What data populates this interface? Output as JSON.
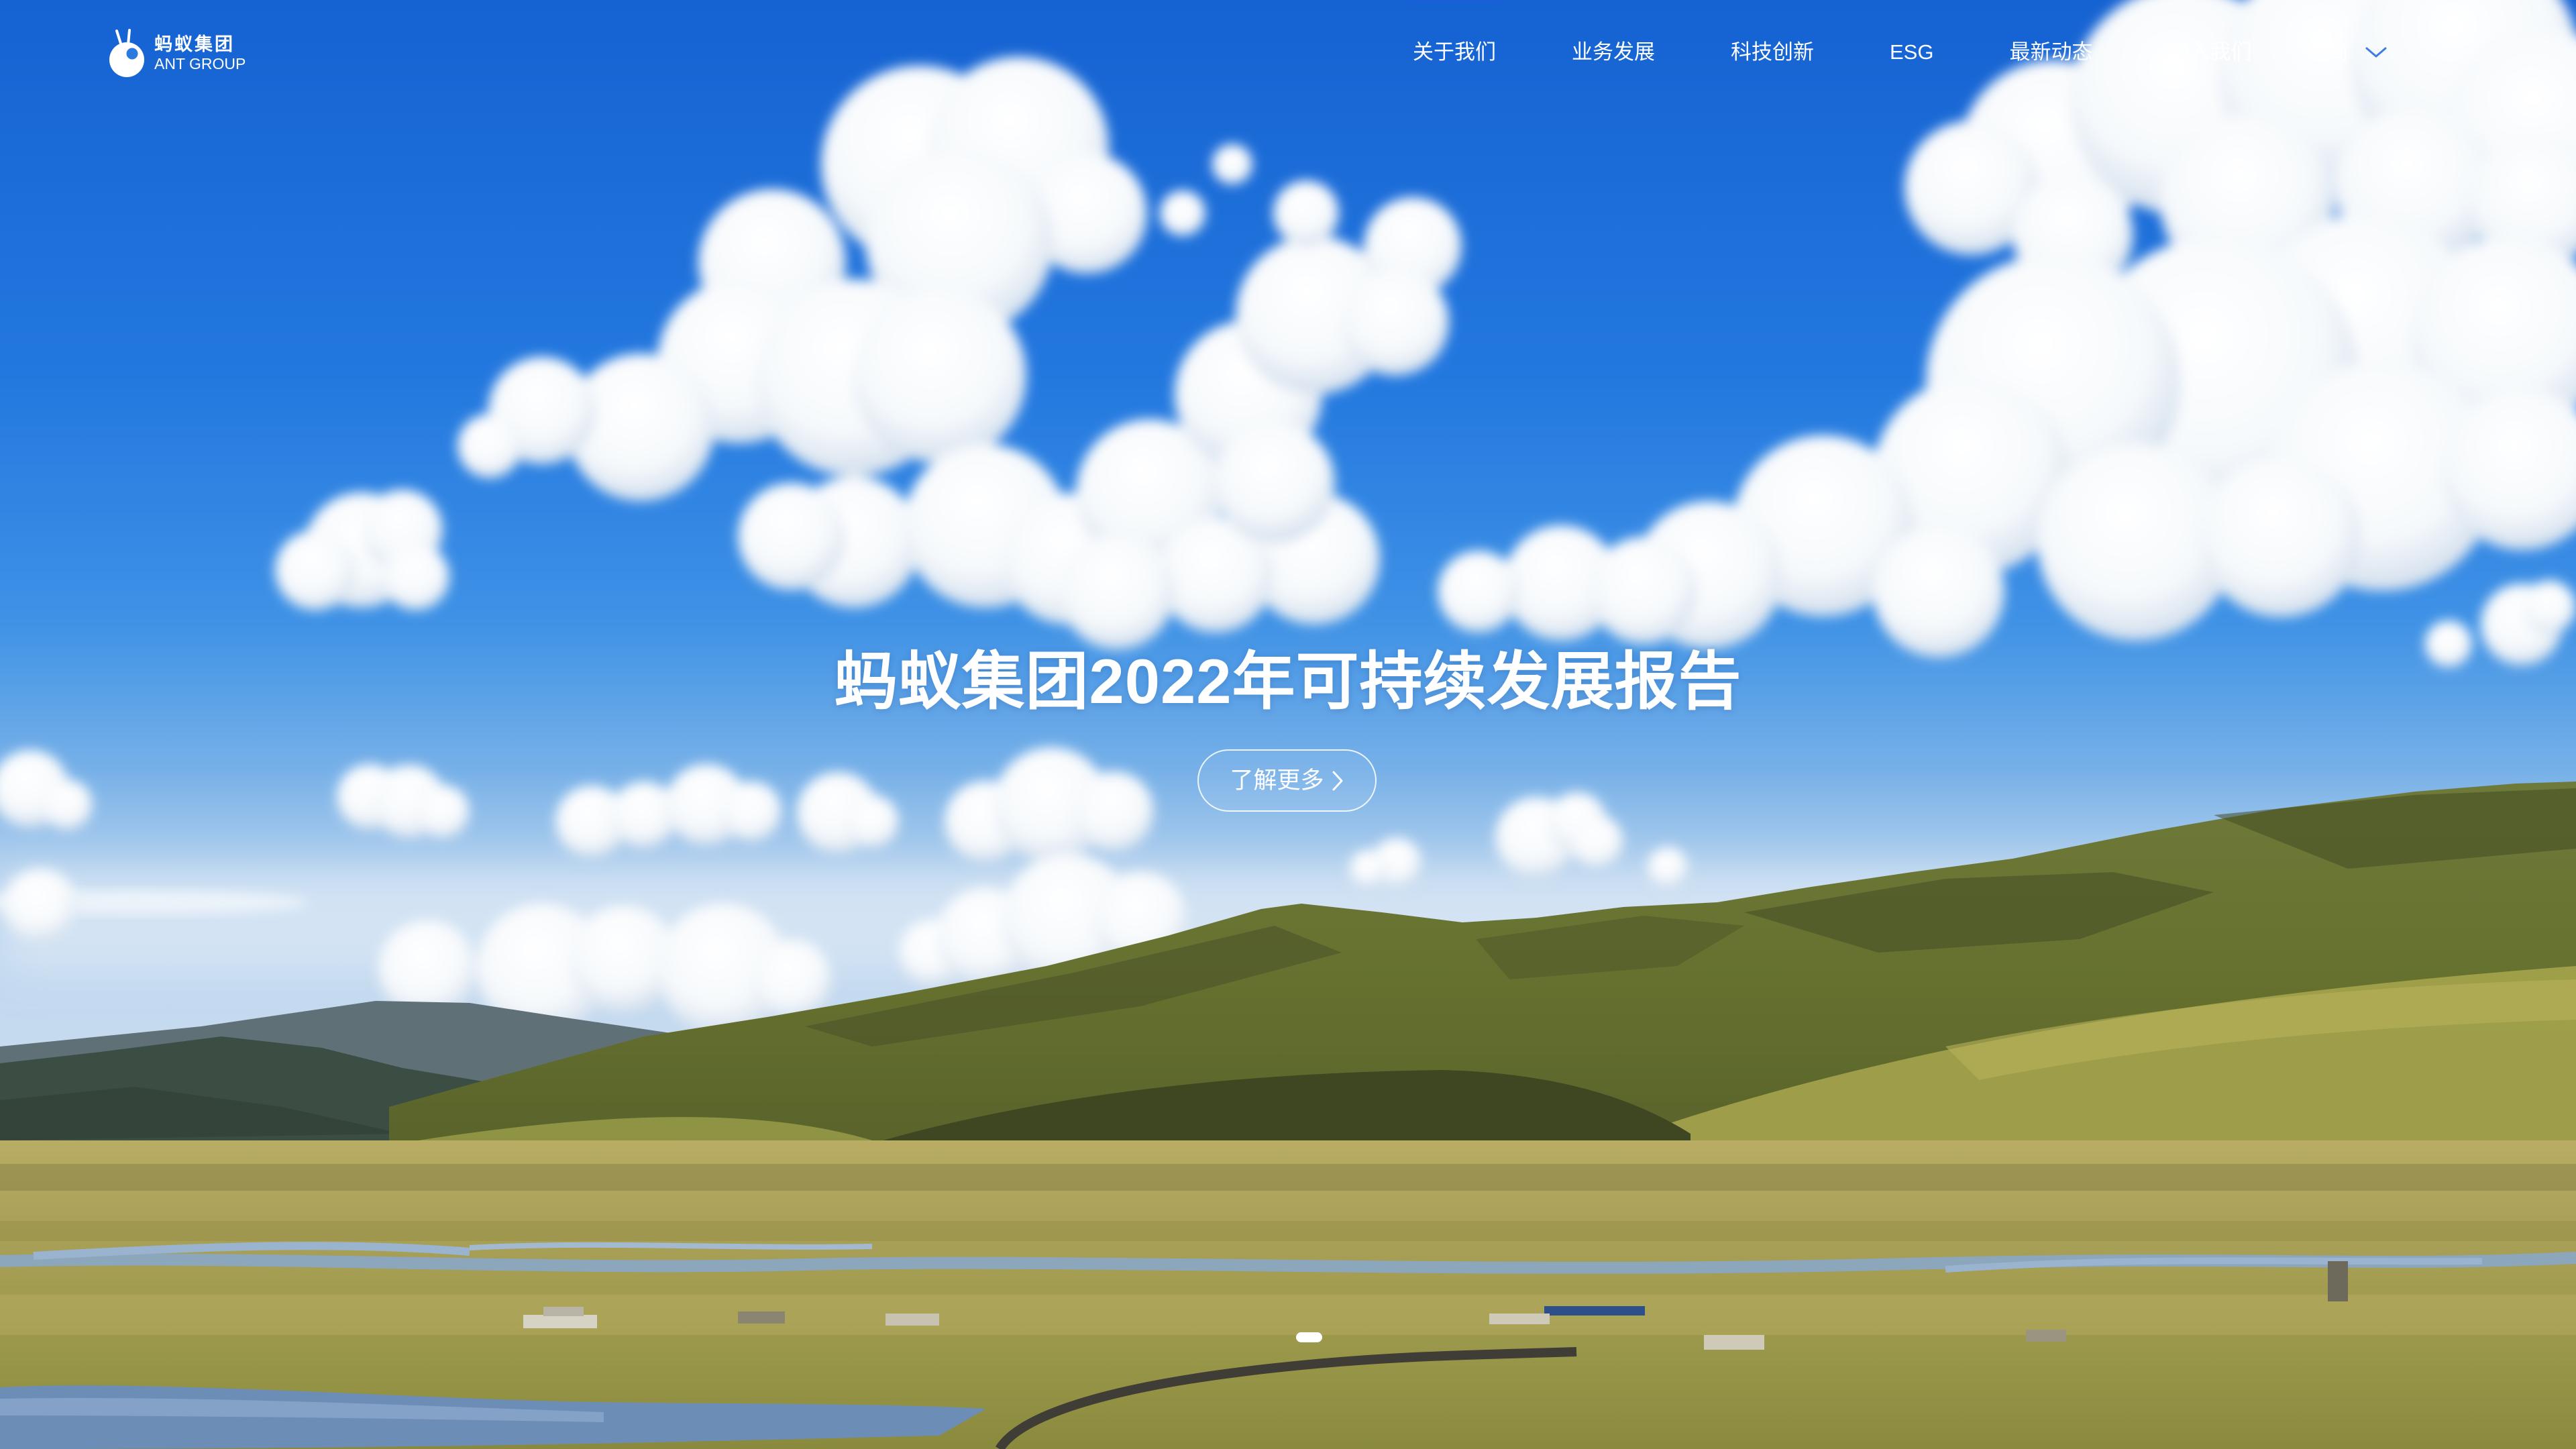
{
  "logo": {
    "cn": "蚂蚁集团",
    "en": "ANT GROUP",
    "icon": "ant-group-logo-icon"
  },
  "nav": {
    "items": [
      {
        "label": "关于我们"
      },
      {
        "label": "业务发展"
      },
      {
        "label": "科技创新"
      },
      {
        "label": "ESG"
      },
      {
        "label": "最新动态"
      },
      {
        "label": "加入我们"
      }
    ],
    "language": {
      "label": "简",
      "icon": "chevron-down-icon"
    }
  },
  "hero": {
    "title": "蚂蚁集团2022年可持续发展报告",
    "cta": {
      "label": "了解更多",
      "icon": "chevron-right-icon"
    }
  },
  "colors": {
    "nav_text": "#ffffff",
    "active_indicator": "#1a5fd9",
    "language_chevron": "#3d7be6",
    "title": "#ffffff",
    "sky": "#2a7fe0"
  }
}
